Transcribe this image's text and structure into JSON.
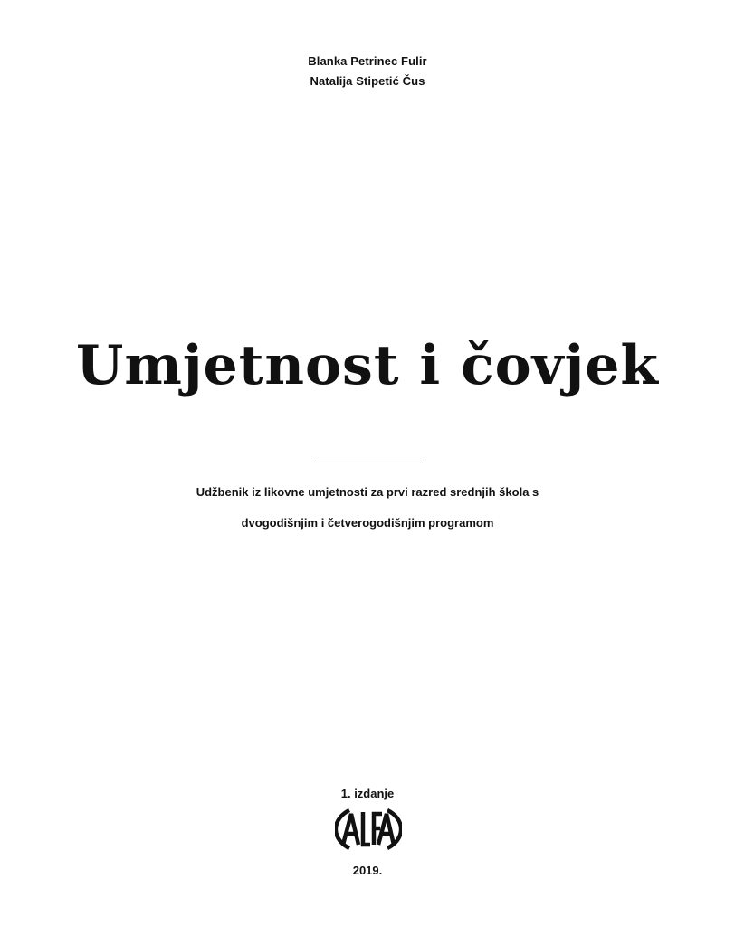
{
  "authors": [
    "Blanka Petrinec Fulir",
    "Natalija Stipetić Čus"
  ],
  "title": "Umjetnost i čovjek",
  "subtitle": {
    "line1": "Udžbenik iz likovne umjetnosti za prvi razred srednjih škola s",
    "line2": "dvogodišnjim i četverogodišnjim programom"
  },
  "edition": "1. izdanje",
  "publisher": {
    "logo_text": "ALFA",
    "logo_icon": "alfa-publisher-logo"
  },
  "year": "2019."
}
